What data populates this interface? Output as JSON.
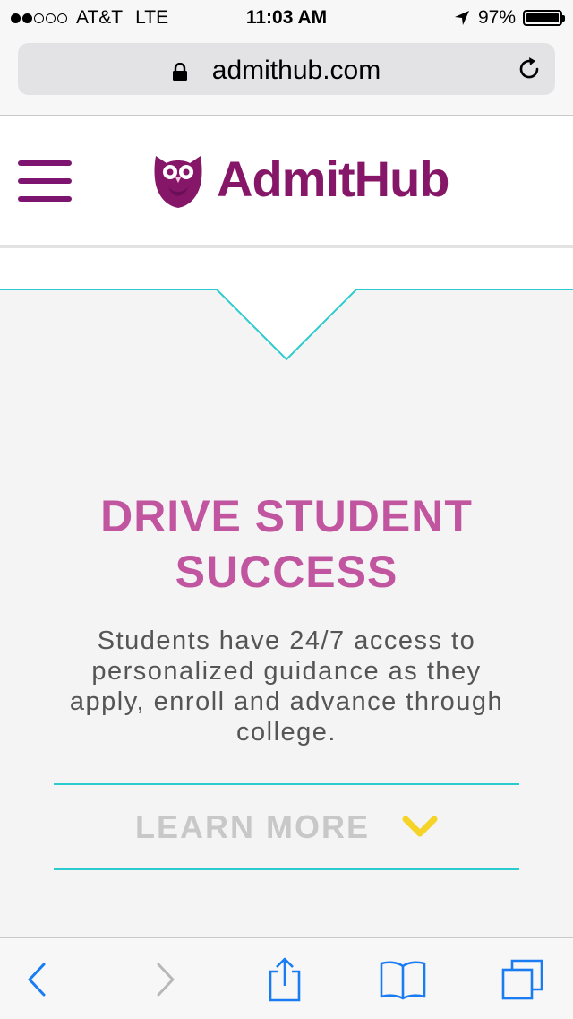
{
  "status_bar": {
    "carrier": "AT&T",
    "network": "LTE",
    "time": "11:03 AM",
    "battery": "97%",
    "battery_level": 0.97,
    "signal_bars": 2
  },
  "browser": {
    "url": "admithub.com"
  },
  "header": {
    "brand": "AdmitHub",
    "brand_color": "#851668",
    "menu_color": "#7d1470"
  },
  "hero": {
    "title_line1": "DRIVE STUDENT",
    "title_line2": "SUCCESS",
    "body": "Students have 24/7 access to personalized guidance as they apply, enroll and advance through college.",
    "title_color": "#c2559f",
    "accent_line_color": "#2ccbcf"
  },
  "cta": {
    "label": "LEARN MORE",
    "icon": "chevron-down-icon",
    "icon_color": "#f5d328"
  },
  "toolbar": {
    "buttons": [
      "back-icon",
      "forward-icon",
      "share-icon",
      "bookmarks-icon",
      "tabs-icon"
    ],
    "accent": "#1a7cf2"
  }
}
